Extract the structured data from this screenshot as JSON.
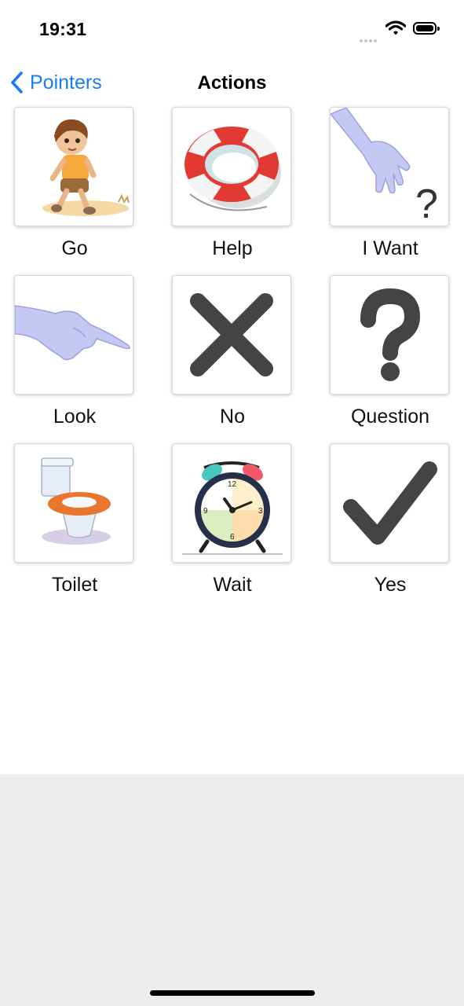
{
  "status_bar": {
    "time": "19:31"
  },
  "nav": {
    "back_label": "Pointers",
    "title": "Actions"
  },
  "tiles": [
    {
      "label": "Go",
      "icon": "child-walking-icon"
    },
    {
      "label": "Help",
      "icon": "life-ring-icon"
    },
    {
      "label": "I Want",
      "icon": "hand-reaching-question-icon"
    },
    {
      "label": "Look",
      "icon": "pointing-hand-icon"
    },
    {
      "label": "No",
      "icon": "x-mark-icon"
    },
    {
      "label": "Question",
      "icon": "question-mark-icon"
    },
    {
      "label": "Toilet",
      "icon": "toilet-icon"
    },
    {
      "label": "Wait",
      "icon": "alarm-clock-icon"
    },
    {
      "label": "Yes",
      "icon": "check-mark-icon"
    }
  ],
  "colors": {
    "accent": "#1a7cf5",
    "symbol": "#444444",
    "lower_area": "#ededed"
  }
}
